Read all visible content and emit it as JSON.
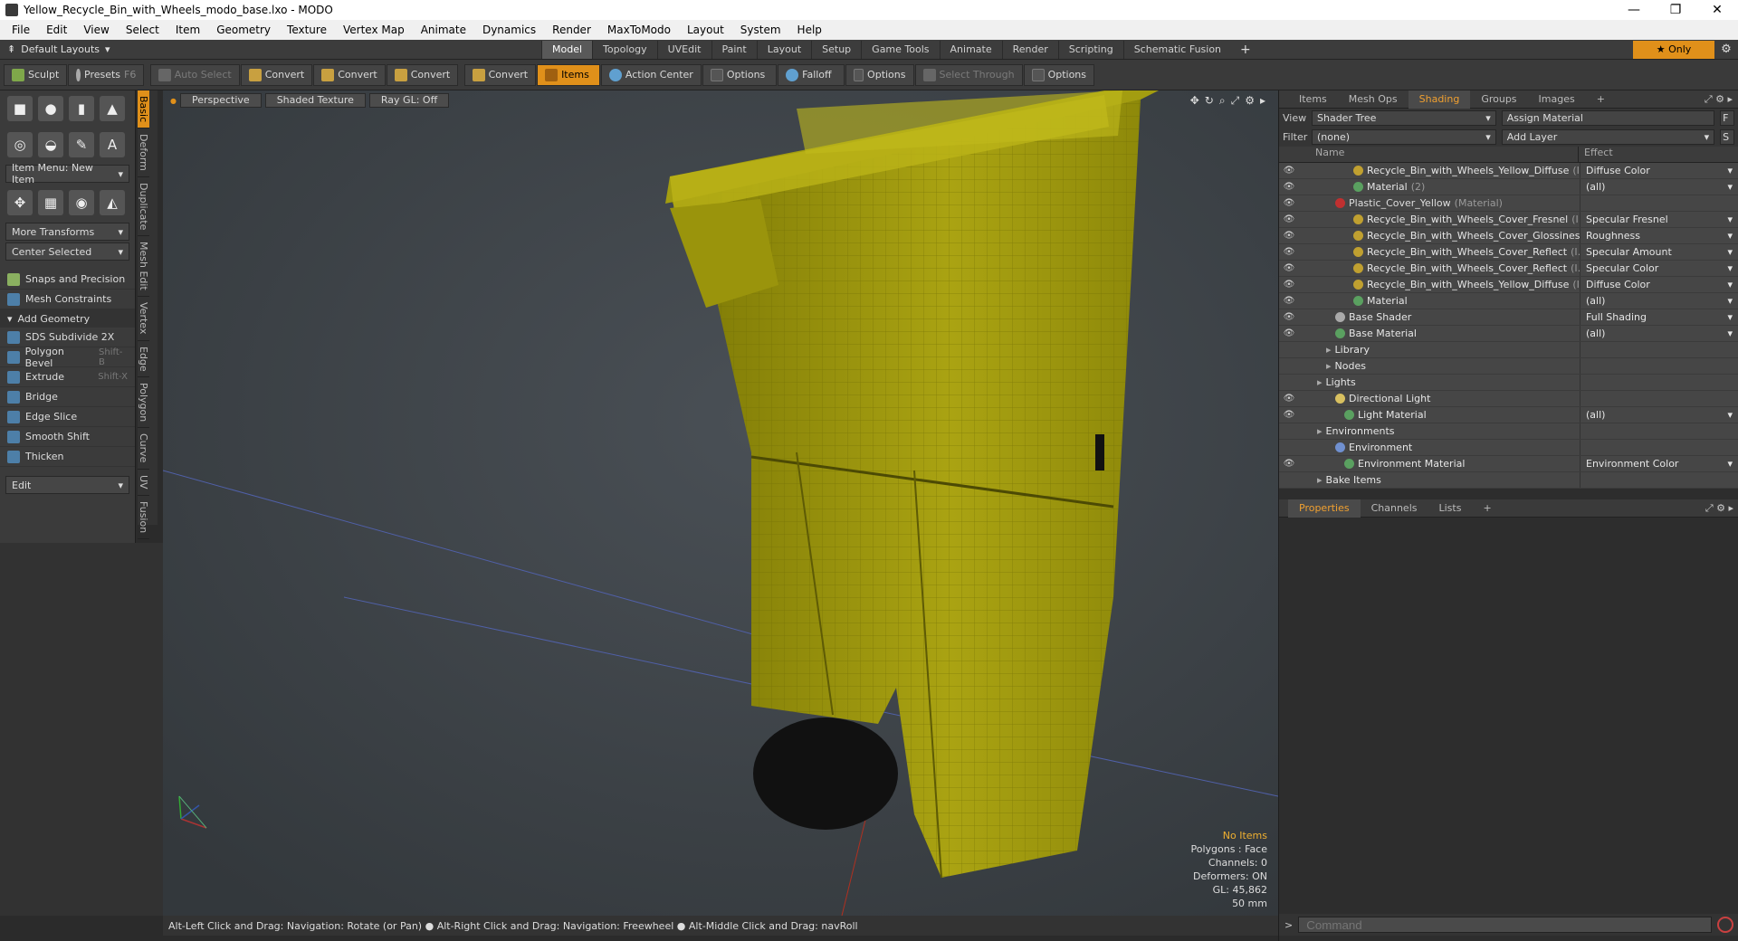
{
  "window": {
    "title": "Yellow_Recycle_Bin_with_Wheels_modo_base.lxo - MODO",
    "minimize": "—",
    "maximize": "❐",
    "close": "✕"
  },
  "menu": [
    "File",
    "Edit",
    "View",
    "Select",
    "Item",
    "Geometry",
    "Texture",
    "Vertex Map",
    "Animate",
    "Dynamics",
    "Render",
    "MaxToModo",
    "Layout",
    "System",
    "Help"
  ],
  "layoutbar": {
    "default_layouts": "Default Layouts",
    "tabs": [
      "Model",
      "Topology",
      "UVEdit",
      "Paint",
      "Layout",
      "Setup",
      "Game Tools",
      "Animate",
      "Render",
      "Scripting",
      "Schematic Fusion"
    ],
    "active_tab": "Model",
    "plus": "+",
    "only": "★ Only"
  },
  "toolbar": {
    "sculpt": "Sculpt",
    "presets": "Presets",
    "presets_shortcut": "F6",
    "auto_select": "Auto Select",
    "convert1": "Convert",
    "convert2": "Convert",
    "convert3": "Convert",
    "convert4": "Convert",
    "items": "Items",
    "action_center": "Action Center",
    "options1": "Options",
    "falloff": "Falloff",
    "options2": "Options",
    "select_through": "Select Through",
    "options3": "Options"
  },
  "left": {
    "item_menu": "Item Menu: New Item",
    "more_transforms": "More Transforms",
    "center_selected": "Center Selected",
    "snaps": "Snaps and Precision",
    "mesh_constraints": "Mesh Constraints",
    "add_geometry": "Add Geometry",
    "tools": [
      {
        "label": "SDS Subdivide 2X",
        "shortcut": ""
      },
      {
        "label": "Polygon Bevel",
        "shortcut": "Shift-B"
      },
      {
        "label": "Extrude",
        "shortcut": "Shift-X"
      },
      {
        "label": "Bridge",
        "shortcut": ""
      },
      {
        "label": "Edge Slice",
        "shortcut": ""
      },
      {
        "label": "Smooth Shift",
        "shortcut": ""
      },
      {
        "label": "Thicken",
        "shortcut": ""
      }
    ],
    "edit": "Edit",
    "vtabs": [
      "Basic",
      "Deform",
      "Duplicate",
      "Mesh Edit",
      "Vertex",
      "Edge",
      "Polygon",
      "Curve",
      "UV",
      "Fusion"
    ]
  },
  "viewport": {
    "perspective": "Perspective",
    "shaded_texture": "Shaded Texture",
    "ray_gl": "Ray GL: Off",
    "stats": {
      "no_items": "No Items",
      "polygons": "Polygons : Face",
      "channels": "Channels: 0",
      "deformers": "Deformers: ON",
      "gl": "GL: 45,862",
      "focal": "50 mm"
    },
    "colors": {
      "bin": "#b0aa12",
      "bin_dark": "#8a8508",
      "wheel": "#121212",
      "background": "#3f4448"
    }
  },
  "statusbar": "Alt-Left Click and Drag: Navigation: Rotate (or Pan) ● Alt-Right Click and Drag: Navigation: Freewheel ● Alt-Middle Click and Drag: navRoll",
  "right": {
    "tabs": [
      "Items",
      "Mesh Ops",
      "Shading",
      "Groups",
      "Images"
    ],
    "active_tab": "Shading",
    "view_label": "View",
    "view_value": "Shader Tree",
    "assign_material": "Assign Material",
    "filter_label": "Filter",
    "filter_value": "(none)",
    "add_layer": "Add Layer",
    "col_name": "Name",
    "col_effect": "Effect",
    "tree": [
      {
        "indent": 6,
        "name": "Recycle_Bin_with_Wheels_Yellow_Diffuse",
        "sub": "(I…",
        "effect": "Diffuse Color",
        "dot": "#c0a030",
        "eye": true
      },
      {
        "indent": 6,
        "name": "Material",
        "sub": "(2)",
        "effect": "(all)",
        "dot": "#5aa060",
        "eye": true
      },
      {
        "indent": 4,
        "name": "Plastic_Cover_Yellow",
        "sub": "(Material)",
        "effect": "",
        "dot": "#c03030",
        "eye": true,
        "dimname": true
      },
      {
        "indent": 6,
        "name": "Recycle_Bin_with_Wheels_Cover_Fresnel",
        "sub": "(I…",
        "effect": "Specular Fresnel",
        "dot": "#c0a030",
        "eye": true
      },
      {
        "indent": 6,
        "name": "Recycle_Bin_with_Wheels_Cover_Glossines",
        "sub": "…",
        "effect": "Roughness",
        "dot": "#c0a030",
        "eye": true
      },
      {
        "indent": 6,
        "name": "Recycle_Bin_with_Wheels_Cover_Reflect",
        "sub": "(I…",
        "effect": "Specular Amount",
        "dot": "#c0a030",
        "eye": true
      },
      {
        "indent": 6,
        "name": "Recycle_Bin_with_Wheels_Cover_Reflect",
        "sub": "(I…",
        "effect": "Specular Color",
        "dot": "#c0a030",
        "eye": true
      },
      {
        "indent": 6,
        "name": "Recycle_Bin_with_Wheels_Yellow_Diffuse",
        "sub": "(I…",
        "effect": "Diffuse Color",
        "dot": "#c0a030",
        "eye": true
      },
      {
        "indent": 6,
        "name": "Material",
        "sub": "",
        "effect": "(all)",
        "dot": "#5aa060",
        "eye": true
      },
      {
        "indent": 4,
        "name": "Base Shader",
        "sub": "",
        "effect": "Full Shading",
        "dot": "#aaaaaa",
        "eye": true
      },
      {
        "indent": 4,
        "name": "Base Material",
        "sub": "",
        "effect": "(all)",
        "dot": "#5aa060",
        "eye": true
      },
      {
        "indent": 3,
        "name": "Library",
        "sub": "",
        "effect": "",
        "dot": "",
        "eye": false
      },
      {
        "indent": 3,
        "name": "Nodes",
        "sub": "",
        "effect": "",
        "dot": "",
        "eye": false
      },
      {
        "indent": 2,
        "name": "Lights",
        "sub": "",
        "effect": "",
        "dot": "",
        "eye": false
      },
      {
        "indent": 4,
        "name": "Directional Light",
        "sub": "",
        "effect": "",
        "dot": "#d8c060",
        "eye": true
      },
      {
        "indent": 5,
        "name": "Light Material",
        "sub": "",
        "effect": "(all)",
        "dot": "#5aa060",
        "eye": true
      },
      {
        "indent": 2,
        "name": "Environments",
        "sub": "",
        "effect": "",
        "dot": "",
        "eye": false
      },
      {
        "indent": 4,
        "name": "Environment",
        "sub": "",
        "effect": "",
        "dot": "#7090d0",
        "eye": false
      },
      {
        "indent": 5,
        "name": "Environment Material",
        "sub": "",
        "effect": "Environment Color",
        "dot": "#5aa060",
        "eye": true
      },
      {
        "indent": 2,
        "name": "Bake Items",
        "sub": "",
        "effect": "",
        "dot": "",
        "eye": false
      }
    ],
    "prop_tabs": [
      "Properties",
      "Channels",
      "Lists"
    ],
    "active_prop_tab": "Properties",
    "command_placeholder": "Command"
  }
}
